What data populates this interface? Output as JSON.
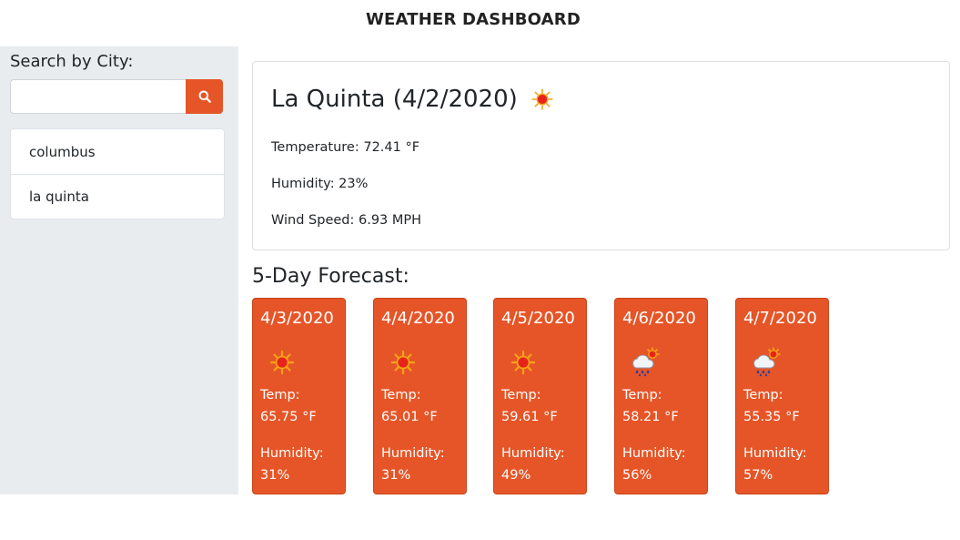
{
  "header": {
    "title": "WEATHER DASHBOARD"
  },
  "sidebar": {
    "search_label": "Search by City:",
    "search_value": "",
    "search_icon": "search-icon",
    "history": [
      {
        "label": "columbus"
      },
      {
        "label": "la quinta"
      }
    ]
  },
  "current": {
    "city_date": "La Quinta (4/2/2020)",
    "icon": "sun-icon",
    "temperature": "Temperature: 72.41 °F",
    "humidity": "Humidity: 23%",
    "wind": "Wind Speed: 6.93 MPH"
  },
  "forecast": {
    "title": "5-Day Forecast:",
    "temp_label": "Temp:",
    "humidity_label": "Humidity:",
    "days": [
      {
        "date": "4/3/2020",
        "icon": "sun-icon",
        "temp": "65.75 °F",
        "humidity": "31%"
      },
      {
        "date": "4/4/2020",
        "icon": "sun-icon",
        "temp": "65.01 °F",
        "humidity": "31%"
      },
      {
        "date": "4/5/2020",
        "icon": "sun-icon",
        "temp": "59.61 °F",
        "humidity": "49%"
      },
      {
        "date": "4/6/2020",
        "icon": "rain-cloud-sun-icon",
        "temp": "58.21 °F",
        "humidity": "56%"
      },
      {
        "date": "4/7/2020",
        "icon": "rain-cloud-sun-icon",
        "temp": "55.35 °F",
        "humidity": "57%"
      }
    ]
  },
  "colors": {
    "accent": "#e65527",
    "sidebar_bg": "#e9ecef"
  }
}
